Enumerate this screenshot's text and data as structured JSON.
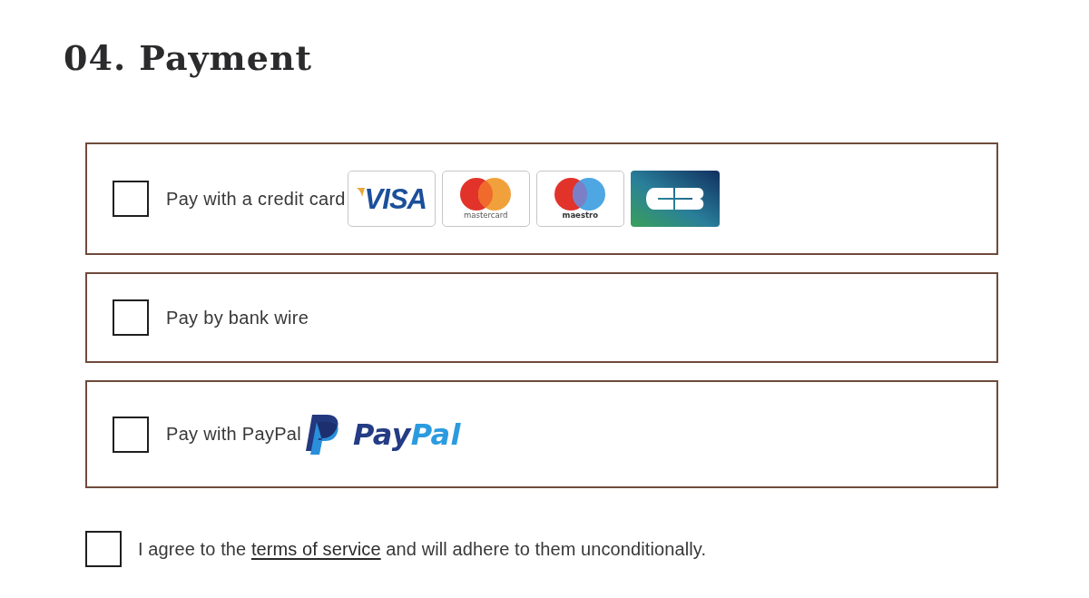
{
  "heading": "04. Payment",
  "payment_options": [
    {
      "kind": "cards",
      "label": "Pay with a credit card",
      "checked": false,
      "cards": [
        {
          "kind": "visa",
          "label": "VISA"
        },
        {
          "kind": "mastercard",
          "label": "mastercard"
        },
        {
          "kind": "maestro",
          "label": "maestro"
        },
        {
          "kind": "cb"
        }
      ]
    },
    {
      "kind": "plain",
      "label": "Pay by bank wire",
      "checked": false
    },
    {
      "kind": "paypal",
      "label": "Pay with PayPal",
      "checked": false,
      "logo_text": [
        {
          "text": "Pay",
          "color": "#243c85"
        },
        {
          "text": "Pal",
          "color": "#2b9be0"
        }
      ]
    }
  ],
  "terms": {
    "checked": false,
    "text_before": "I agree to the ",
    "link": "terms of service",
    "text_after": " and will adhere to them unconditionally."
  }
}
